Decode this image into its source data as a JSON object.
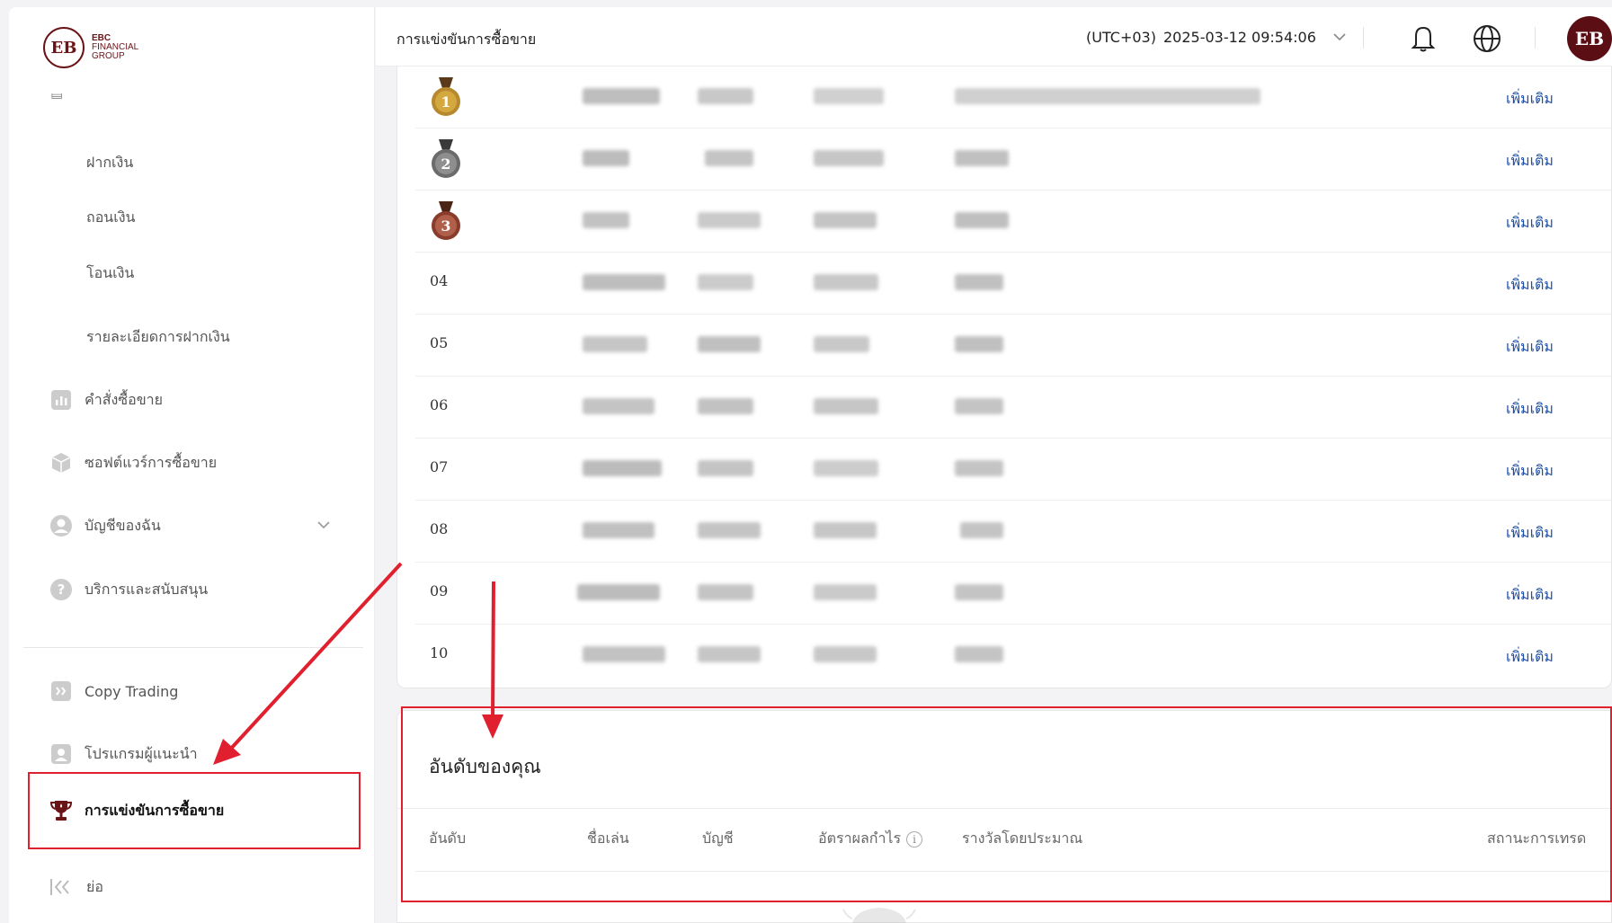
{
  "brand": {
    "initials": "EB",
    "line1": "EBC",
    "line2": "FINANCIAL",
    "line3": "GROUP"
  },
  "sidebar": {
    "items": [
      {
        "label": "ฝากเงิน",
        "icon": "none"
      },
      {
        "label": "ถอนเงิน",
        "icon": "none"
      },
      {
        "label": "โอนเงิน",
        "icon": "none"
      },
      {
        "label": "รายละเอียดการฝากเงิน",
        "icon": "none"
      },
      {
        "label": "คำสั่งซื้อขาย",
        "icon": "chart-icon"
      },
      {
        "label": "ซอฟต์แวร์การซื้อขาย",
        "icon": "cube-icon"
      },
      {
        "label": "บัญชีของฉัน",
        "icon": "user-icon"
      },
      {
        "label": "บริการและสนับสนุน",
        "icon": "help-icon"
      },
      {
        "label": "Copy Trading",
        "icon": "copy-icon"
      },
      {
        "label": "โปรแกรมผู้แนะนำ",
        "icon": "referral-icon"
      },
      {
        "label": "การแข่งขันการซื้อขาย",
        "icon": "trophy-icon"
      },
      {
        "label": "ย่อ",
        "icon": "collapse-icon"
      }
    ]
  },
  "header": {
    "title": "การแข่งขันการซื้อขาย",
    "timezone": "(UTC+03)",
    "datetime": "2025-03-12 09:54:06",
    "icons": [
      "bell-icon",
      "globe-icon",
      "avatar"
    ]
  },
  "leaderboard": {
    "rows": [
      {
        "rank": "1",
        "more": "เพิ่มเติม",
        "medal": "gold"
      },
      {
        "rank": "2",
        "more": "เพิ่มเติม",
        "medal": "silver"
      },
      {
        "rank": "3",
        "more": "เพิ่มเติม",
        "medal": "bronze"
      },
      {
        "rank": "04",
        "more": "เพิ่มเติม"
      },
      {
        "rank": "05",
        "more": "เพิ่มเติม"
      },
      {
        "rank": "06",
        "more": "เพิ่มเติม"
      },
      {
        "rank": "07",
        "more": "เพิ่มเติม"
      },
      {
        "rank": "08",
        "more": "เพิ่มเติม"
      },
      {
        "rank": "09",
        "more": "เพิ่มเติม"
      },
      {
        "rank": "10",
        "more": "เพิ่มเติม"
      }
    ]
  },
  "my_ranking": {
    "title": "อันดับของคุณ",
    "columns": [
      "อันดับ",
      "ชื่อเล่น",
      "บัญชี",
      "อัตราผลกำไร",
      "รางวัลโดยประมาณ",
      "สถานะการเทรด"
    ]
  },
  "colors": {
    "brand": "#6b1418",
    "link": "#1d4fa8",
    "highlight": "#e0202e"
  }
}
